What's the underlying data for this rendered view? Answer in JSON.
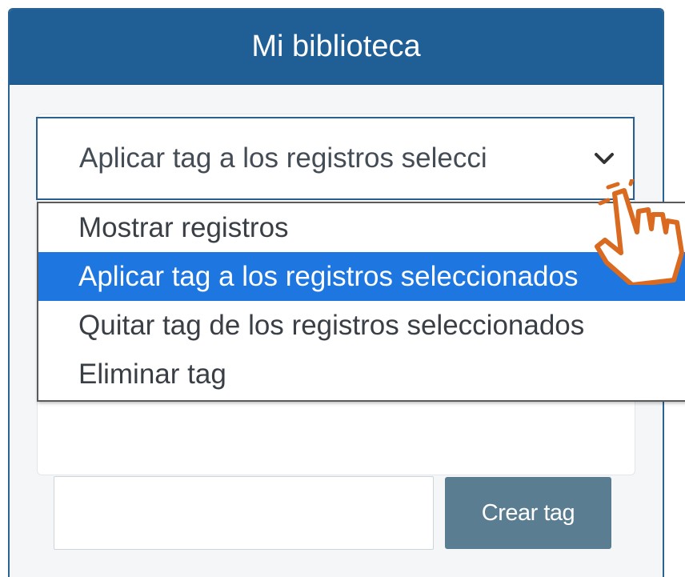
{
  "panel": {
    "title": "Mi biblioteca"
  },
  "select": {
    "value": "Aplicar tag a los registros selecci",
    "icon": "chevron-down-icon"
  },
  "dropdown": {
    "options": [
      {
        "label": "Mostrar registros",
        "selected": false
      },
      {
        "label": "Aplicar tag a los registros seleccionados",
        "selected": true
      },
      {
        "label": "Quitar tag de los registros seleccionados",
        "selected": false
      },
      {
        "label": "Eliminar tag",
        "selected": false
      }
    ]
  },
  "tag_form": {
    "input_value": "",
    "button_label": "Crear tag"
  },
  "cursor": {
    "icon": "hand-pointer-icon"
  },
  "colors": {
    "header": "#1f5f95",
    "selected_option": "#1e77e1",
    "button": "#5a7d92",
    "cursor_accent": "#d96a1f"
  }
}
